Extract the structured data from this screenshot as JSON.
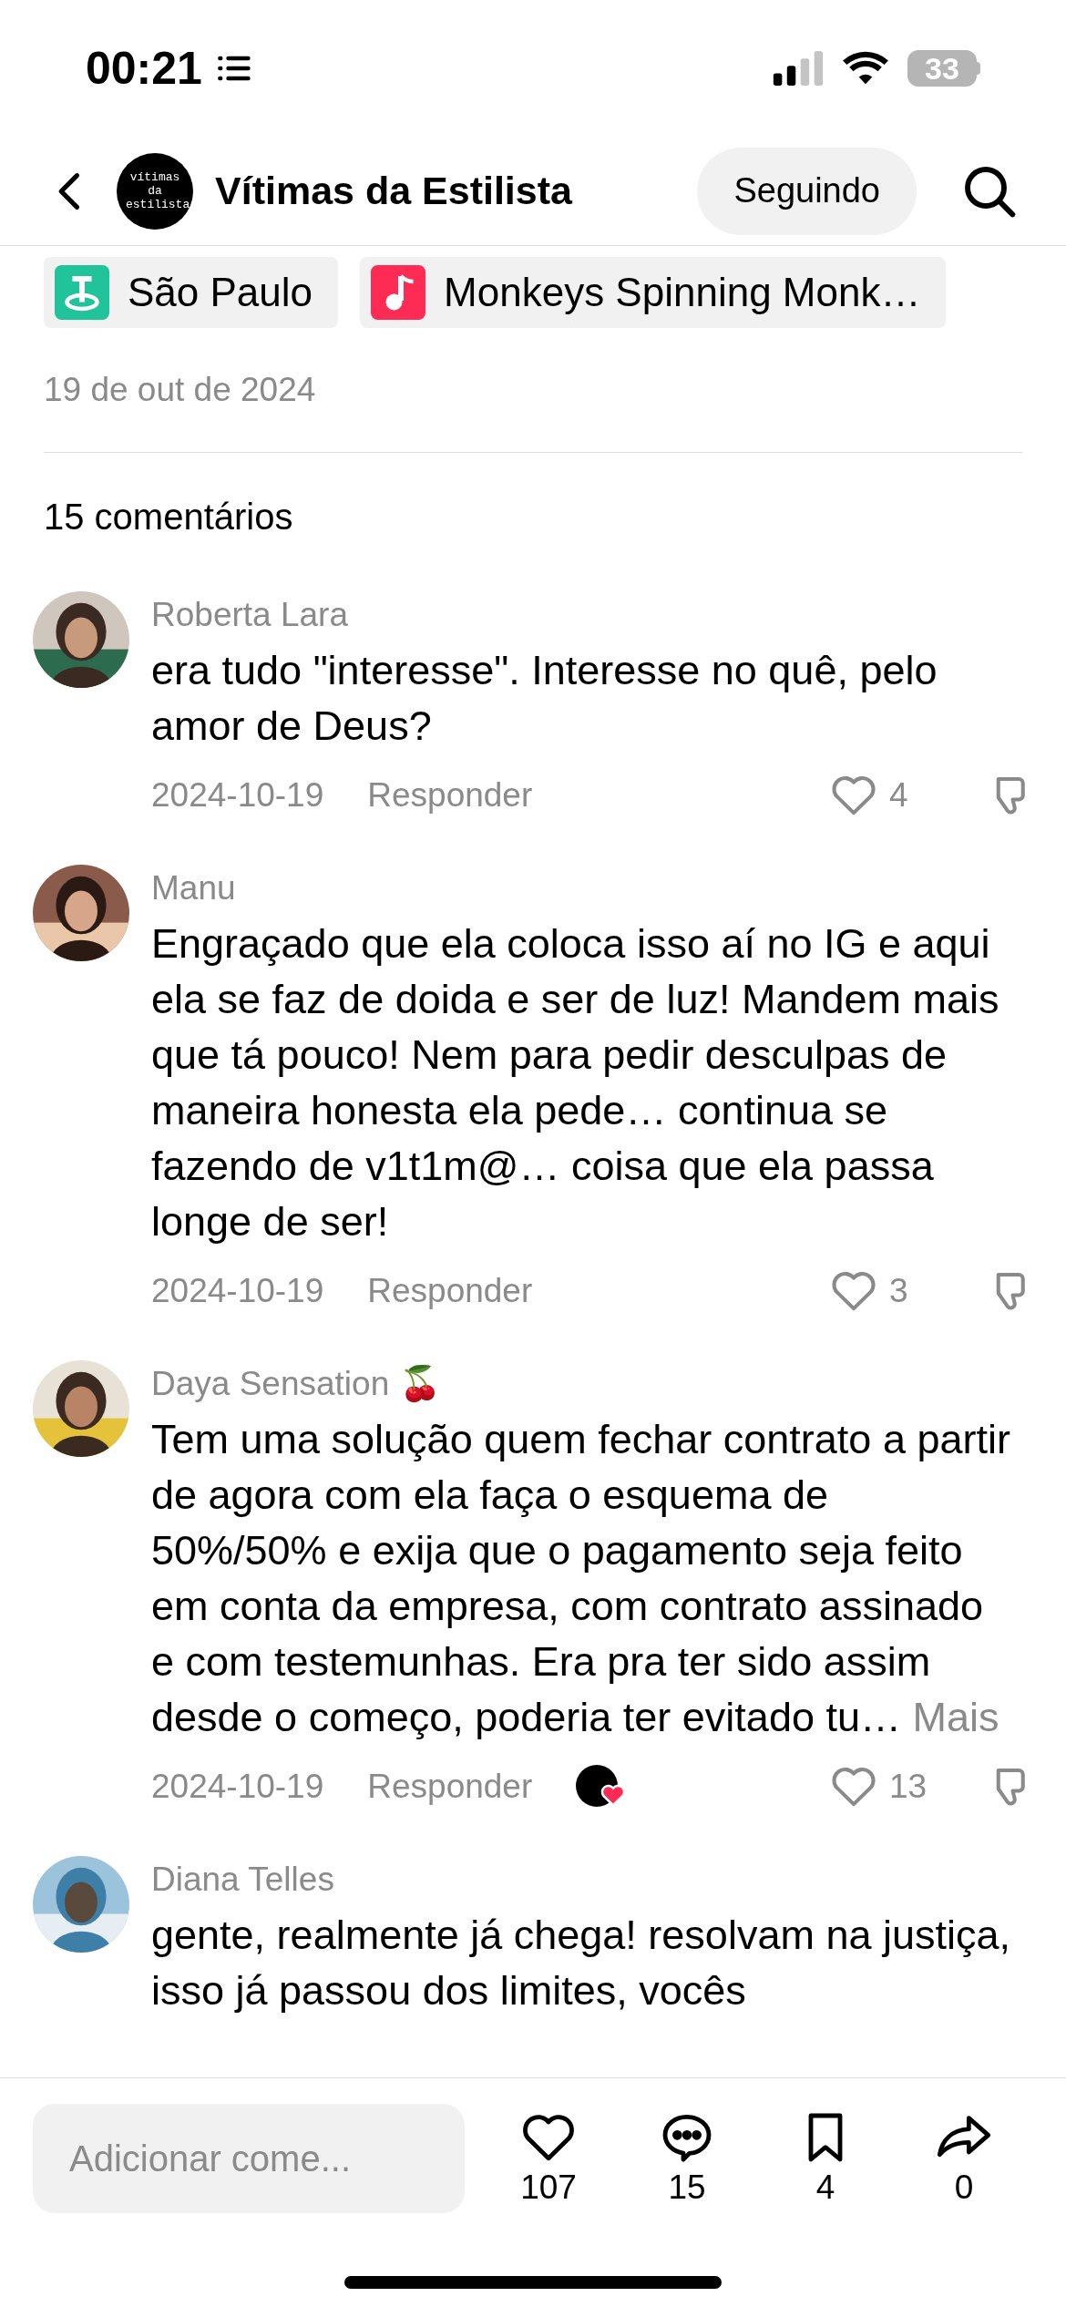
{
  "status_bar": {
    "time": "00:21",
    "battery": "33"
  },
  "header": {
    "account_name": "Vítimas da Estilista",
    "avatar_text": "vítimas da estilista",
    "follow_button": "Seguindo"
  },
  "chips": [
    {
      "kind": "location",
      "label": "São Paulo"
    },
    {
      "kind": "music",
      "label": "Monkeys Spinning Monk…"
    }
  ],
  "post_date": "19 de out de 2024",
  "comments_count": "15 comentários",
  "comments": [
    {
      "author": "Roberta Lara",
      "text": "era tudo \"interesse\". Interesse no quê, pelo amor de Deus?",
      "date": "2024-10-19",
      "reply": "Responder",
      "likes": "4",
      "creator_liked": false
    },
    {
      "author": "Manu",
      "text": "Engraçado que ela coloca isso aí no IG e aqui ela se faz de doida e ser de luz! Mandem mais que tá pouco! Nem para pedir desculpas de maneira honesta ela pede… continua se fazendo de v1t1m@… coisa que ela passa longe de ser!",
      "date": "2024-10-19",
      "reply": "Responder",
      "likes": "3",
      "creator_liked": false
    },
    {
      "author": "Daya Sensation 🍒",
      "text": "Tem uma solução quem fechar contrato a partir de agora com ela faça o esquema de 50%/50% e exija que o pagamento seja feito em conta da empresa, com contrato assinado e com testemunhas. Era pra ter sido assim desde o começo, poderia ter evitado tu…",
      "more": "Mais",
      "date": "2024-10-19",
      "reply": "Responder",
      "likes": "13",
      "creator_liked": true
    },
    {
      "author": "Diana Telles",
      "text": "gente, realmente já chega! resolvam na justiça, isso já passou dos limites, vocês"
    }
  ],
  "bottom_bar": {
    "placeholder": "Adicionar come...",
    "likes": "107",
    "comments": "15",
    "saves": "4",
    "shares": "0"
  }
}
